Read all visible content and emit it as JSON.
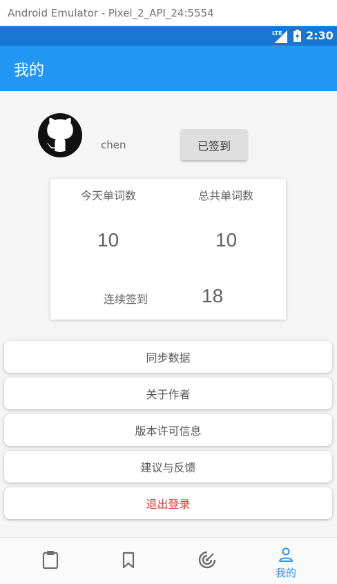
{
  "window": {
    "title": "Android Emulator - Pixel_2_API_24:5554"
  },
  "status_bar": {
    "time": "2:30",
    "network": "LTE"
  },
  "app_bar": {
    "title": "我的"
  },
  "profile": {
    "username": "chen",
    "sign_in_button": "已签到",
    "avatar_icon": "github-octocat-icon"
  },
  "stats": {
    "today_label": "今天单词数",
    "total_label": "总共单词数",
    "today_value": "10",
    "total_value": "10",
    "streak_label": "连续签到",
    "streak_value": "18"
  },
  "menu": [
    {
      "label": "同步数据"
    },
    {
      "label": "关于作者"
    },
    {
      "label": "版本许可信息"
    },
    {
      "label": "建议与反馈"
    },
    {
      "label": "退出登录"
    }
  ],
  "bottom_nav": {
    "items": [
      {
        "icon": "clipboard-icon",
        "label": ""
      },
      {
        "icon": "bookmark-icon",
        "label": ""
      },
      {
        "icon": "radar-icon",
        "label": ""
      },
      {
        "icon": "person-icon",
        "label": "我的",
        "active": true
      }
    ]
  },
  "colors": {
    "primary": "#2196F3",
    "primary_dark": "#1976D2",
    "logout": "#E53935"
  }
}
